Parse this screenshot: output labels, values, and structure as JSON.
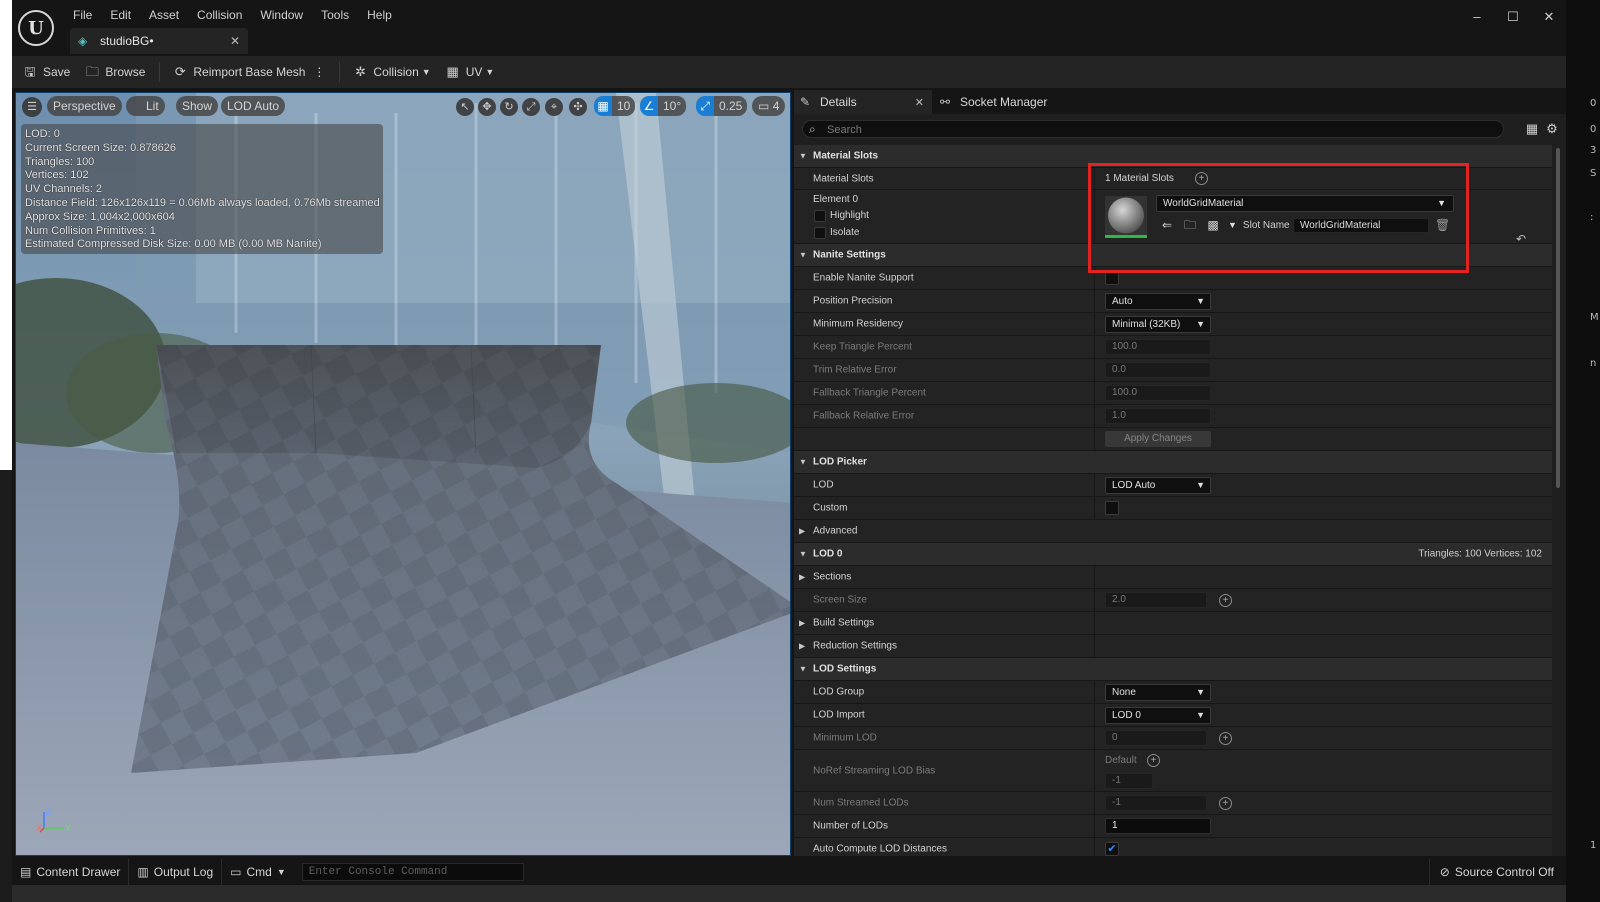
{
  "app": {
    "menu": [
      "File",
      "Edit",
      "Asset",
      "Collision",
      "Window",
      "Tools",
      "Help"
    ],
    "document_tab": "studioBG•",
    "window_controls": [
      "–",
      "☐",
      "✕"
    ]
  },
  "toolbar": {
    "save": "Save",
    "browse": "Browse",
    "reimport": "Reimport Base Mesh",
    "collision": "Collision",
    "uv": "UV"
  },
  "viewport": {
    "perspective": "Perspective",
    "lit": "Lit",
    "show": "Show",
    "lod_auto": "LOD Auto",
    "grid_snap": "10",
    "rotation_snap": "10°",
    "scale_snap": "0.25",
    "camera_speed": "4",
    "stats": [
      "LOD:  0",
      "Current Screen Size:  0.878626",
      "Triangles:  100",
      "Vertices:  102",
      "UV Channels:  2",
      "Distance Field:  126x126x119 = 0.06Mb always loaded, 0.76Mb streamed",
      "Approx Size: 1,004x2,000x604",
      "Num Collision Primitives:  1",
      "Estimated Compressed Disk Size: 0.00 MB (0.00 MB Nanite)"
    ],
    "axis": {
      "z": "Z",
      "x": "X",
      "y": "Y"
    }
  },
  "details": {
    "tab_details": "Details",
    "tab_socket": "Socket Manager",
    "search_placeholder": "Search",
    "material_slots": {
      "category": "Material Slots",
      "label": "Material Slots",
      "count": "1 Material Slots",
      "element": "Element 0",
      "highlight": "Highlight",
      "isolate": "Isolate",
      "material": "WorldGridMaterial",
      "slot_name_label": "Slot Name",
      "slot_name": "WorldGridMaterial"
    },
    "nanite": {
      "category": "Nanite Settings",
      "enable": "Enable Nanite Support",
      "position_precision": "Position Precision",
      "position_precision_value": "Auto",
      "min_residency": "Minimum Residency",
      "min_residency_value": "Minimal (32KB)",
      "keep_triangle": "Keep Triangle Percent",
      "keep_triangle_value": "100.0",
      "trim_error": "Trim Relative Error",
      "trim_error_value": "0.0",
      "fallback_triangle": "Fallback Triangle Percent",
      "fallback_triangle_value": "100.0",
      "fallback_error": "Fallback Relative Error",
      "fallback_error_value": "1.0",
      "apply": "Apply Changes"
    },
    "lod_picker": {
      "category": "LOD Picker",
      "lod": "LOD",
      "lod_value": "LOD Auto",
      "custom": "Custom",
      "advanced": "Advanced"
    },
    "lod0": {
      "category": "LOD 0",
      "info": "Triangles: 100   Vertices: 102",
      "sections": "Sections",
      "screen_size": "Screen Size",
      "screen_size_value": "2.0",
      "build": "Build Settings",
      "reduction": "Reduction Settings"
    },
    "lod_settings": {
      "category": "LOD Settings",
      "lod_group": "LOD Group",
      "lod_group_value": "None",
      "lod_import": "LOD Import",
      "lod_import_value": "LOD 0",
      "min_lod": "Minimum LOD",
      "min_lod_value": "0",
      "noref": "NoRef Streaming LOD Bias",
      "noref_default": "Default",
      "noref_value": "-1",
      "num_streamed": "Num Streamed LODs",
      "num_streamed_value": "-1",
      "num_lods": "Number of LODs",
      "num_lods_value": "1",
      "auto_compute": "Auto Compute LOD Distances"
    }
  },
  "statusbar": {
    "content_drawer": "Content Drawer",
    "output_log": "Output Log",
    "cmd": "Cmd",
    "console_placeholder": "Enter Console Command",
    "source_control": "Source Control Off"
  },
  "edge_fragments": [
    "0",
    "0",
    "3",
    "S",
    ":",
    "M",
    "n",
    "1"
  ],
  "colors": {
    "highlight_box": "#e32222",
    "accent_blue": "#1a7fd4",
    "material_bar": "#2fb84a"
  }
}
